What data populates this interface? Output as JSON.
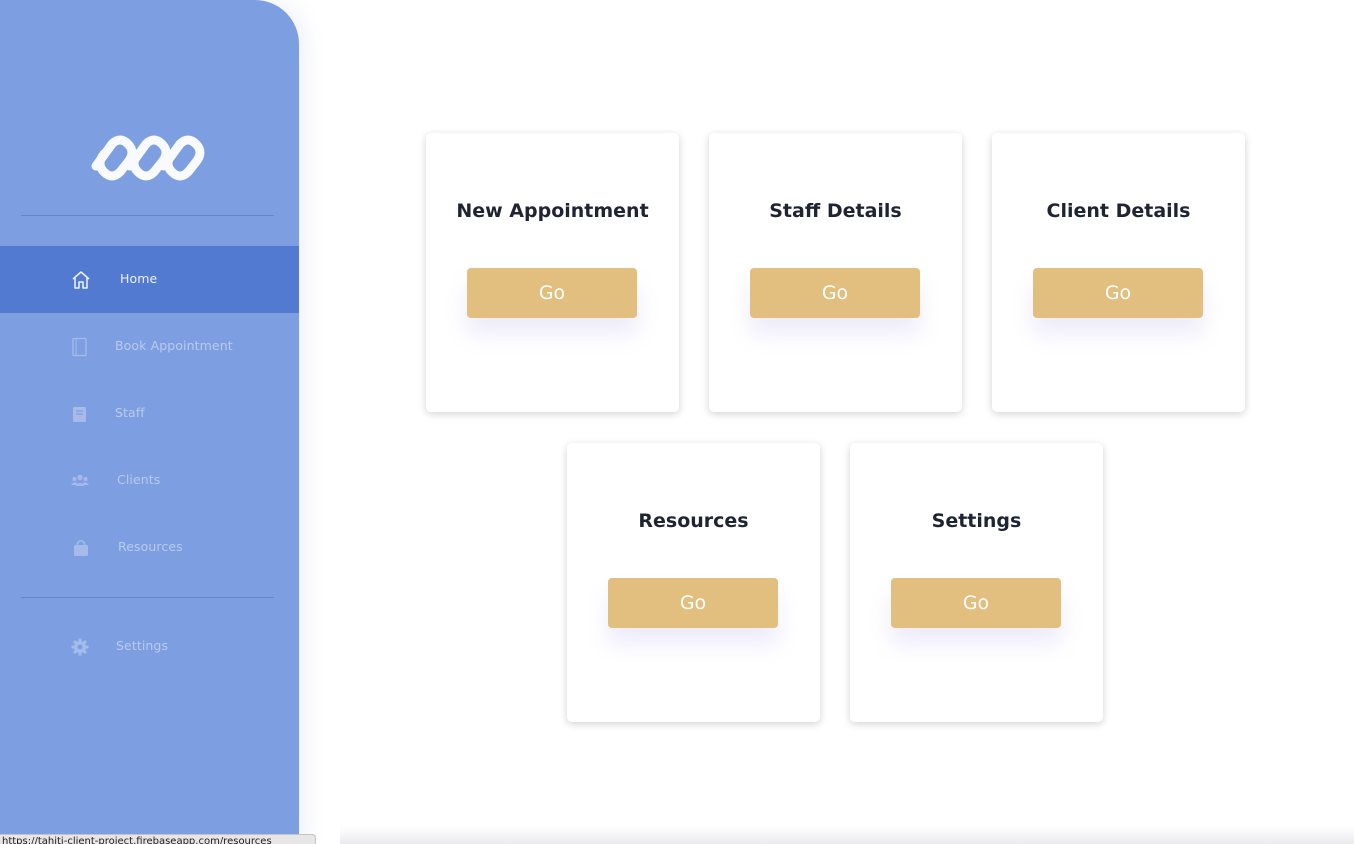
{
  "sidebar": {
    "logo_name": "chain-link-logo",
    "items": [
      {
        "label": "Home",
        "icon": "home-icon",
        "active": true
      },
      {
        "label": "Book Appointment",
        "icon": "book-icon",
        "active": false
      },
      {
        "label": "Staff",
        "icon": "staff-book-icon",
        "active": false
      },
      {
        "label": "Clients",
        "icon": "users-icon",
        "active": false
      },
      {
        "label": "Resources",
        "icon": "bag-icon",
        "active": false
      },
      {
        "label": "Settings",
        "icon": "gear-icon",
        "active": false
      }
    ]
  },
  "cards": [
    {
      "title": "New Appointment",
      "button": "Go"
    },
    {
      "title": "Staff Details",
      "button": "Go"
    },
    {
      "title": "Client Details",
      "button": "Go"
    },
    {
      "title": "Resources",
      "button": "Go"
    },
    {
      "title": "Settings",
      "button": "Go"
    }
  ],
  "status_bar": {
    "url": "https://tahiti-client-project.firebaseapp.com/resources"
  },
  "colors": {
    "sidebar_bg": "#7d9fe2",
    "active_item_bg": "#527ad0",
    "button_bg": "#e2be7f",
    "title_text": "#1f2433"
  }
}
